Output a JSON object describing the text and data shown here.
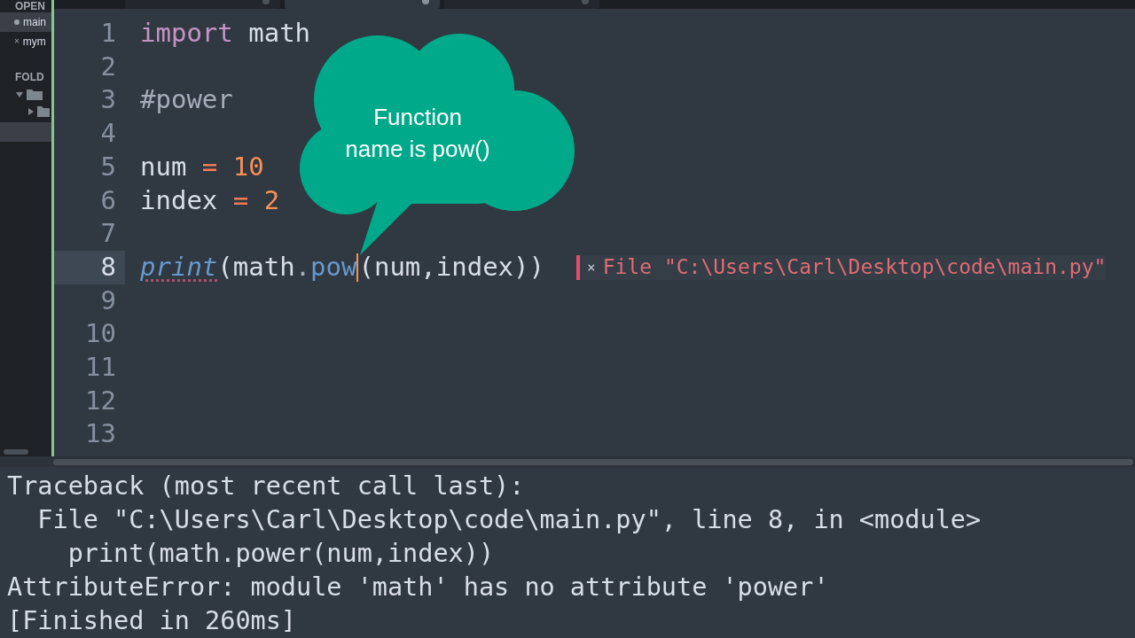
{
  "tabs": [
    {
      "selected": false,
      "modified": false
    },
    {
      "selected": true,
      "modified": true
    },
    {
      "selected": false,
      "modified": false
    }
  ],
  "sidebar": {
    "open_header": "OPEN",
    "open_files": [
      {
        "name": "main",
        "selected": true,
        "kind": "unsaved"
      },
      {
        "name": "mym",
        "selected": false,
        "kind": "saved"
      }
    ],
    "folders_header": "FOLD"
  },
  "editor": {
    "lines": [
      {
        "number": "1",
        "current": false,
        "tokens": [
          {
            "kind": "keyword",
            "text": "import"
          },
          {
            "kind": "plain",
            "text": " math"
          }
        ]
      },
      {
        "number": "2",
        "current": false
      },
      {
        "number": "3",
        "current": false,
        "tokens": [
          {
            "kind": "comment",
            "text": "#power"
          }
        ]
      },
      {
        "number": "4",
        "current": false
      },
      {
        "number": "5",
        "current": false,
        "tokens": [
          {
            "kind": "plain",
            "text": "num "
          },
          {
            "kind": "operator",
            "text": "= "
          },
          {
            "kind": "number",
            "text": "10"
          }
        ]
      },
      {
        "number": "6",
        "current": false,
        "tokens": [
          {
            "kind": "plain",
            "text": "index "
          },
          {
            "kind": "operator",
            "text": "= "
          },
          {
            "kind": "number",
            "text": "2"
          }
        ]
      },
      {
        "number": "7",
        "current": false
      },
      {
        "number": "8",
        "current": true,
        "tokens": [
          {
            "kind": "builtin",
            "text": "print"
          },
          {
            "kind": "plain",
            "text": "(math"
          },
          {
            "kind": "punct",
            "text": "."
          },
          {
            "kind": "function",
            "text": "pow",
            "caret": true
          },
          {
            "kind": "plain",
            "text": "(num,index))"
          }
        ],
        "error": {
          "icon": "×",
          "text": "File \"C:\\Users\\Carl\\Desktop\\code\\main.py\""
        }
      },
      {
        "number": "9",
        "current": false
      },
      {
        "number": "10",
        "current": false
      },
      {
        "number": "11",
        "current": false
      },
      {
        "number": "12",
        "current": false
      },
      {
        "number": "13",
        "current": false
      }
    ],
    "callout": {
      "lines": [
        "Function",
        "name is pow()"
      ]
    }
  },
  "console": {
    "lines": [
      "Traceback (most recent call last):",
      "  File \"C:\\Users\\Carl\\Desktop\\code\\main.py\", line 8, in <module>",
      "    print(math.power(num,index))",
      "AttributeError: module 'math' has no attribute 'power'",
      "[Finished in 260ms]"
    ]
  }
}
